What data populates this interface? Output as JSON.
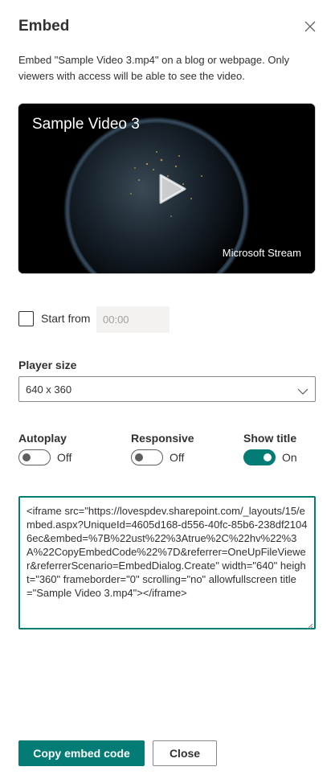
{
  "panel": {
    "title": "Embed",
    "description": "Embed \"Sample Video 3.mp4\" on a blog or webpage. Only viewers with access will be able to see the video."
  },
  "video": {
    "title": "Sample Video 3",
    "brand": "Microsoft Stream"
  },
  "start_from": {
    "label": "Start from",
    "value": "00:00",
    "checked": false
  },
  "player_size": {
    "label": "Player size",
    "selected": "640 x 360"
  },
  "toggles": {
    "autoplay": {
      "label": "Autoplay",
      "state": "Off"
    },
    "responsive": {
      "label": "Responsive",
      "state": "Off"
    },
    "show_title": {
      "label": "Show title",
      "state": "On"
    }
  },
  "embed_code": "<iframe src=\"https://lovespdev.sharepoint.com/_layouts/15/embed.aspx?UniqueId=4605d168-d556-40fc-85b6-238df21046ec&embed=%7B%22ust%22%3Atrue%2C%22hv%22%3A%22CopyEmbedCode%22%7D&referrer=OneUpFileViewer&referrerScenario=EmbedDialog.Create\" width=\"640\" height=\"360\" frameborder=\"0\" scrolling=\"no\" allowfullscreen title=\"Sample Video 3.mp4\"></iframe>",
  "buttons": {
    "copy": "Copy embed code",
    "close": "Close"
  },
  "colors": {
    "accent": "#037c75",
    "text": "#323130"
  },
  "icons": {
    "close": "close-icon",
    "play": "play-icon",
    "dropdown": "chevron-down-icon"
  }
}
